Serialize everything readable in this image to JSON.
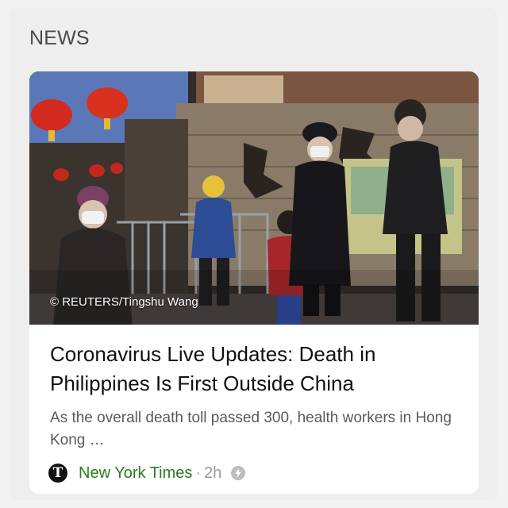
{
  "section": {
    "title": "NEWS"
  },
  "article": {
    "image_credit": "© REUTERS/Tingshu Wang",
    "headline": "Coronavirus Live Updates: Death in Philippines Is First Outside China",
    "summary": "As the overall death toll passed 300, health workers in Hong Kong …",
    "source_logo_letter": "T",
    "source_name": "New York Times",
    "separator": "·",
    "age": "2h",
    "amp_icon": "amp-lightning-icon"
  },
  "colors": {
    "background": "#f2f2f2",
    "card": "#ffffff",
    "source": "#2b7a22",
    "meta": "#9a9a9a"
  }
}
